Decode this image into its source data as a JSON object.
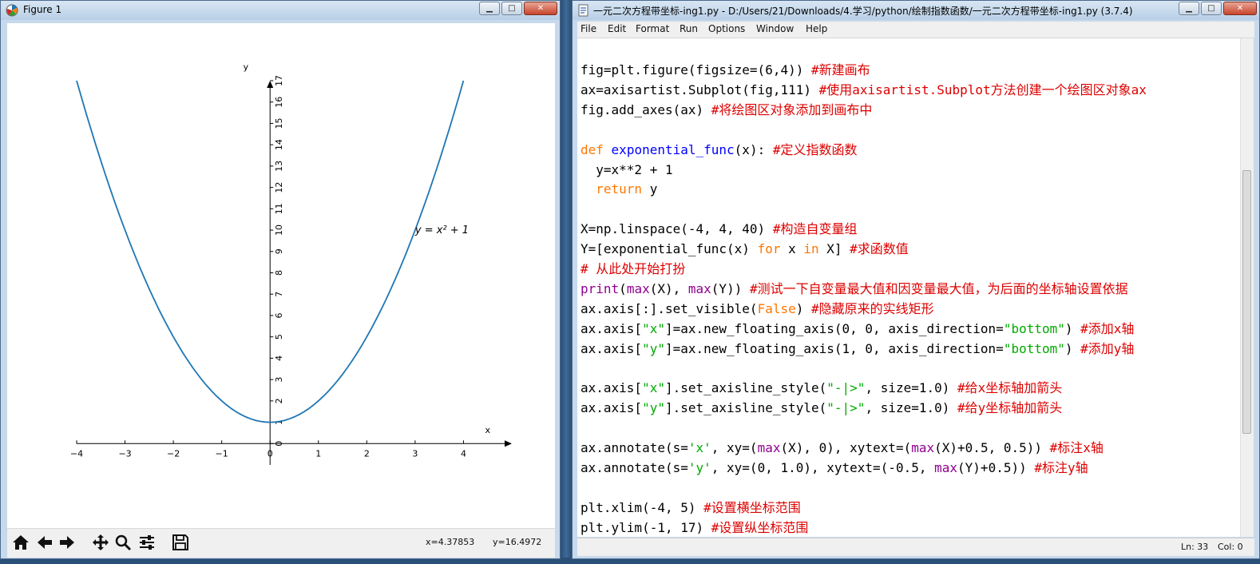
{
  "figure_window": {
    "title": "Figure 1",
    "controls": {
      "minimize": "▁",
      "maximize": "□",
      "close": "✕"
    },
    "toolbar": {
      "home_icon": "home-icon",
      "back_icon": "arrow-left-icon",
      "forward_icon": "arrow-right-icon",
      "pan_icon": "move-icon",
      "zoom_icon": "zoom-icon",
      "configure_icon": "sliders-icon",
      "save_icon": "save-icon"
    },
    "cursor_x": "x=4.37853",
    "cursor_y": "y=16.4972"
  },
  "chart_data": {
    "type": "line",
    "title": "",
    "xlabel": "x",
    "ylabel": "y",
    "xlim": [
      -4,
      5
    ],
    "ylim": [
      -1,
      17
    ],
    "x_ticks": [
      "−4",
      "−3",
      "−2",
      "−1",
      "0",
      "1",
      "2",
      "3",
      "4"
    ],
    "y_ticks": [
      "0",
      "1",
      "2",
      "3",
      "4",
      "5",
      "6",
      "7",
      "8",
      "9",
      "10",
      "11",
      "12",
      "13",
      "14",
      "15",
      "16",
      "17"
    ],
    "annotation": {
      "label": "y = x² + 1",
      "x": 3,
      "y": 10
    },
    "series": [
      {
        "color": "#1f77b4",
        "x": [
          -4.0,
          -3.5,
          -3.0,
          -2.5,
          -2.0,
          -1.5,
          -1.0,
          -0.5,
          0.0,
          0.5,
          1.0,
          1.5,
          2.0,
          2.5,
          3.0,
          3.5,
          4.0
        ],
        "y": [
          17.0,
          13.25,
          10.0,
          7.25,
          5.0,
          3.25,
          2.0,
          1.25,
          1.0,
          1.25,
          2.0,
          3.25,
          5.0,
          7.25,
          10.0,
          13.25,
          17.0
        ]
      }
    ],
    "grid": false
  },
  "editor_window": {
    "title": "一元二次方程带坐标-ing1.py - D:/Users/21/Downloads/4.学习/python/绘制指数函数/一元二次方程带坐标-ing1.py (3.7.4)",
    "controls": {
      "minimize": "▁",
      "maximize": "□",
      "close": "✕"
    },
    "menu": [
      "File",
      "Edit",
      "Format",
      "Run",
      "Options",
      "Window",
      "Help"
    ],
    "status": {
      "line": "Ln: 33",
      "col": "Col: 0"
    },
    "code": [
      [
        {
          "t": "fig=plt.figure(figsize=(6,4)) ",
          "c": ""
        },
        {
          "t": "#新建画布",
          "c": "com"
        }
      ],
      [
        {
          "t": "ax=axisartist.Subplot(fig,111) ",
          "c": ""
        },
        {
          "t": "#使用axisartist.Subplot方法创建一个绘图区对象ax",
          "c": "com"
        }
      ],
      [
        {
          "t": "fig.add_axes(ax) ",
          "c": ""
        },
        {
          "t": "#将绘图区对象添加到画布中",
          "c": "com"
        }
      ],
      [],
      [
        {
          "t": "def",
          "c": "kw"
        },
        {
          "t": " ",
          "c": ""
        },
        {
          "t": "exponential_func",
          "c": "def"
        },
        {
          "t": "(x): ",
          "c": ""
        },
        {
          "t": "#定义指数函数",
          "c": "com"
        }
      ],
      [
        {
          "t": "  y=x**2 + 1",
          "c": ""
        }
      ],
      [
        {
          "t": "  ",
          "c": ""
        },
        {
          "t": "return",
          "c": "kw"
        },
        {
          "t": " y",
          "c": ""
        }
      ],
      [],
      [
        {
          "t": "X=np.linspace(-4, 4, 40) ",
          "c": ""
        },
        {
          "t": "#构造自变量组",
          "c": "com"
        }
      ],
      [
        {
          "t": "Y=[exponential_func(x) ",
          "c": ""
        },
        {
          "t": "for",
          "c": "kw"
        },
        {
          "t": " x ",
          "c": ""
        },
        {
          "t": "in",
          "c": "kw"
        },
        {
          "t": " X] ",
          "c": ""
        },
        {
          "t": "#求函数值",
          "c": "com"
        }
      ],
      [
        {
          "t": "# 从此处开始打扮",
          "c": "com"
        }
      ],
      [
        {
          "t": "print",
          "c": "bi"
        },
        {
          "t": "(",
          "c": ""
        },
        {
          "t": "max",
          "c": "bi"
        },
        {
          "t": "(X), ",
          "c": ""
        },
        {
          "t": "max",
          "c": "bi"
        },
        {
          "t": "(Y)) ",
          "c": ""
        },
        {
          "t": "#测试一下自变量最大值和因变量最大值，为后面的坐标轴设置依据",
          "c": "com"
        }
      ],
      [
        {
          "t": "ax.axis[:].set_visible(",
          "c": ""
        },
        {
          "t": "False",
          "c": "kw"
        },
        {
          "t": ") ",
          "c": ""
        },
        {
          "t": "#隐藏原来的实线矩形",
          "c": "com"
        }
      ],
      [
        {
          "t": "ax.axis[",
          "c": ""
        },
        {
          "t": "\"x\"",
          "c": "str"
        },
        {
          "t": "]=ax.new_floating_axis(0, 0, axis_direction=",
          "c": ""
        },
        {
          "t": "\"bottom\"",
          "c": "str"
        },
        {
          "t": ") ",
          "c": ""
        },
        {
          "t": "#添加x轴",
          "c": "com"
        }
      ],
      [
        {
          "t": "ax.axis[",
          "c": ""
        },
        {
          "t": "\"y\"",
          "c": "str"
        },
        {
          "t": "]=ax.new_floating_axis(1, 0, axis_direction=",
          "c": ""
        },
        {
          "t": "\"bottom\"",
          "c": "str"
        },
        {
          "t": ") ",
          "c": ""
        },
        {
          "t": "#添加y轴",
          "c": "com"
        }
      ],
      [],
      [
        {
          "t": "ax.axis[",
          "c": ""
        },
        {
          "t": "\"x\"",
          "c": "str"
        },
        {
          "t": "].set_axisline_style(",
          "c": ""
        },
        {
          "t": "\"-|>\"",
          "c": "str"
        },
        {
          "t": ", size=1.0) ",
          "c": ""
        },
        {
          "t": "#给x坐标轴加箭头",
          "c": "com"
        }
      ],
      [
        {
          "t": "ax.axis[",
          "c": ""
        },
        {
          "t": "\"y\"",
          "c": "str"
        },
        {
          "t": "].set_axisline_style(",
          "c": ""
        },
        {
          "t": "\"-|>\"",
          "c": "str"
        },
        {
          "t": ", size=1.0) ",
          "c": ""
        },
        {
          "t": "#给y坐标轴加箭头",
          "c": "com"
        }
      ],
      [],
      [
        {
          "t": "ax.annotate(s=",
          "c": ""
        },
        {
          "t": "'x'",
          "c": "str"
        },
        {
          "t": ", xy=(",
          "c": ""
        },
        {
          "t": "max",
          "c": "bi"
        },
        {
          "t": "(X), 0), xytext=(",
          "c": ""
        },
        {
          "t": "max",
          "c": "bi"
        },
        {
          "t": "(X)+0.5, 0.5)) ",
          "c": ""
        },
        {
          "t": "#标注x轴",
          "c": "com"
        }
      ],
      [
        {
          "t": "ax.annotate(s=",
          "c": ""
        },
        {
          "t": "'y'",
          "c": "str"
        },
        {
          "t": ", xy=(0, 1.0), xytext=(-0.5, ",
          "c": ""
        },
        {
          "t": "max",
          "c": "bi"
        },
        {
          "t": "(Y)+0.5)) ",
          "c": ""
        },
        {
          "t": "#标注y轴",
          "c": "com"
        }
      ],
      [],
      [
        {
          "t": "plt.xlim(-4, 5) ",
          "c": ""
        },
        {
          "t": "#设置横坐标范围",
          "c": "com"
        }
      ],
      [
        {
          "t": "plt.ylim(-1, 17) ",
          "c": ""
        },
        {
          "t": "#设置纵坐标范围",
          "c": "com"
        }
      ]
    ]
  }
}
